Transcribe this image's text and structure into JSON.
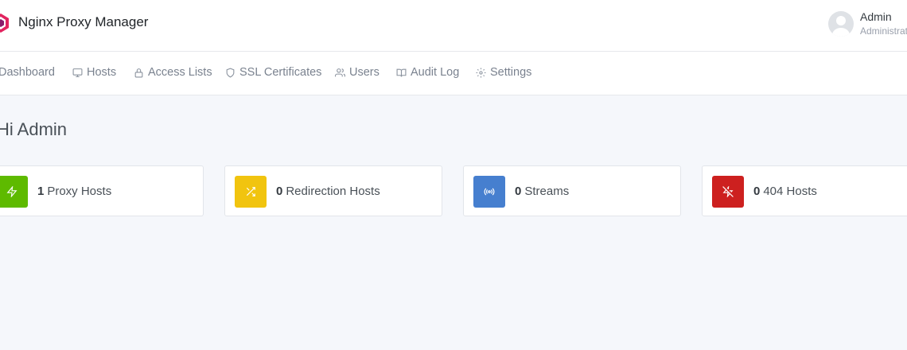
{
  "app": {
    "title": "Nginx Proxy Manager"
  },
  "user": {
    "name": "Admin",
    "role": "Administrator"
  },
  "nav": [
    {
      "label": "Dashboard",
      "icon": "home-icon"
    },
    {
      "label": "Hosts",
      "icon": "monitor-icon"
    },
    {
      "label": "Access Lists",
      "icon": "lock-icon"
    },
    {
      "label": "SSL Certificates",
      "icon": "shield-icon"
    },
    {
      "label": "Users",
      "icon": "users-icon"
    },
    {
      "label": "Audit Log",
      "icon": "book-icon"
    },
    {
      "label": "Settings",
      "icon": "gear-icon"
    }
  ],
  "page": {
    "title": "Hi Admin"
  },
  "cards": [
    {
      "count": "1",
      "label": "Proxy Hosts",
      "color": "#5eba00",
      "icon": "zap-icon"
    },
    {
      "count": "0",
      "label": "Redirection Hosts",
      "color": "#f1c40f",
      "icon": "shuffle-icon"
    },
    {
      "count": "0",
      "label": "Streams",
      "color": "#467fcf",
      "icon": "radio-icon"
    },
    {
      "count": "0",
      "label": "404 Hosts",
      "color": "#cd201f",
      "icon": "zap-off-icon"
    }
  ]
}
